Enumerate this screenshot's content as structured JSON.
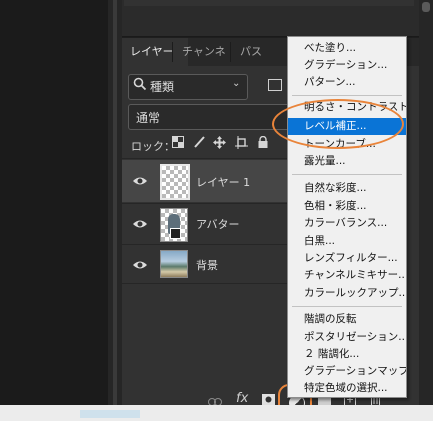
{
  "panel": {
    "tabs": [
      "レイヤー",
      "チャンネル",
      "パス"
    ],
    "filter_label": "種類",
    "blend_mode": "通常",
    "lock_label": "ロック："
  },
  "layers": [
    {
      "name": "レイヤー 1",
      "selected": true
    },
    {
      "name": "アバター",
      "selected": false
    },
    {
      "name": "背景",
      "selected": false
    }
  ],
  "menu": {
    "items": [
      "べた塗り...",
      "グラデーション...",
      "パターン...",
      "明るさ・コントラスト...",
      "レベル補正...",
      "トーンカーブ...",
      "露光量...",
      "自然な彩度...",
      "色相・彩度...",
      "カラーバランス...",
      "白黒...",
      "レンズフィルター...",
      "チャンネルミキサー...",
      "カラールックアップ...",
      "階調の反転",
      "ポスタリゼーション...",
      "２ 階調化...",
      "グラデーションマップ...",
      "特定色域の選択..."
    ],
    "highlighted_index": 4,
    "highlight_color": "#0a74d6"
  },
  "toolbar_icons": [
    "link-icon",
    "fx-icon",
    "mask-icon",
    "adjustment-icon",
    "group-icon",
    "new-layer-icon",
    "trash-icon"
  ],
  "annotation_color": "#e9843a",
  "bottom_bar": {
    "fx_label": "fx"
  }
}
